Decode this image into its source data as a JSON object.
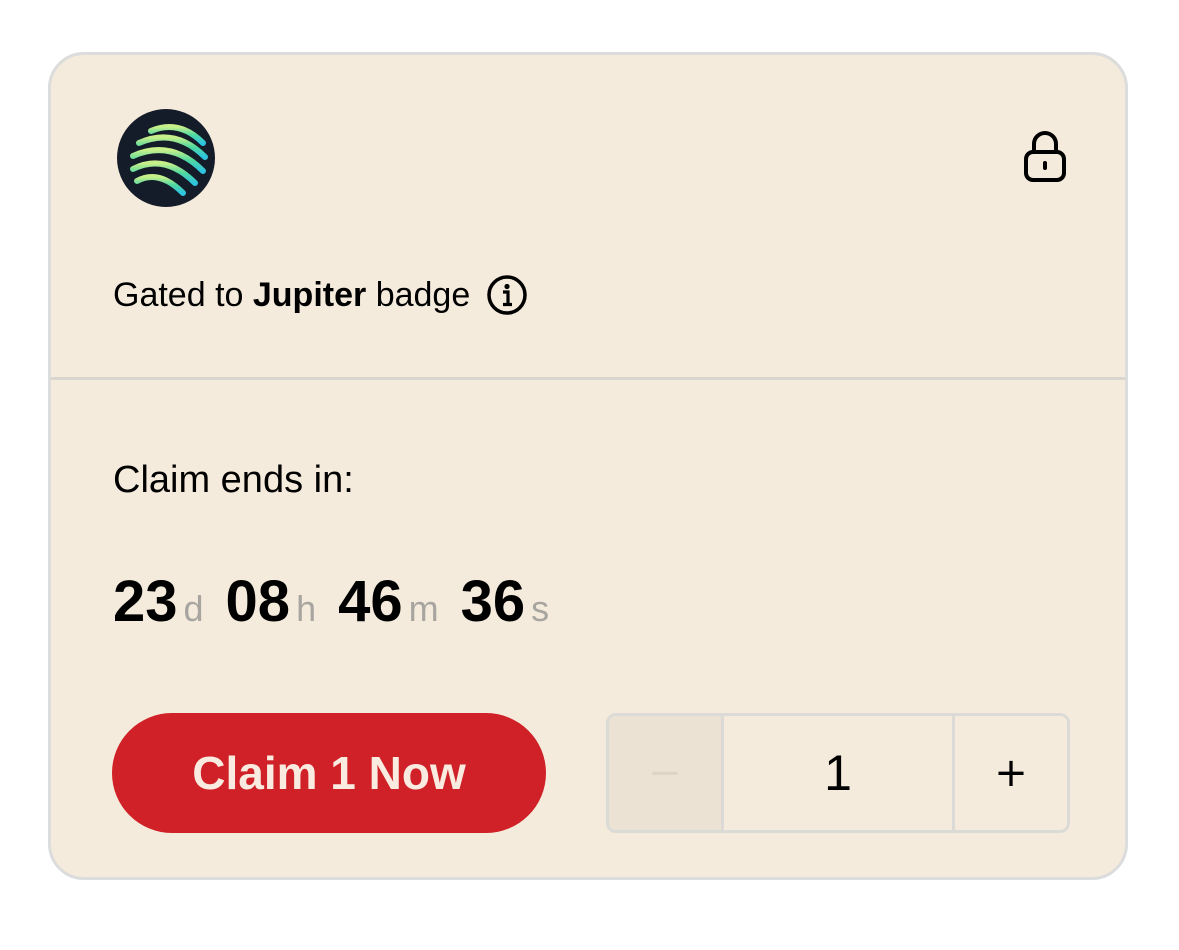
{
  "header": {
    "logo_icon": "jupiter-logo-icon",
    "lock_icon": "lock-icon"
  },
  "gating": {
    "prefix": "Gated to",
    "badge_name": "Jupiter",
    "suffix": "badge",
    "info_icon": "info-icon"
  },
  "claim": {
    "label": "Claim ends in:",
    "countdown": [
      {
        "value": "23",
        "unit": "d"
      },
      {
        "value": "08",
        "unit": "h"
      },
      {
        "value": "46",
        "unit": "m"
      },
      {
        "value": "36",
        "unit": "s"
      }
    ],
    "button_label": "Claim 1 Now"
  },
  "quantity": {
    "minus_label": "−",
    "value": "1",
    "plus_label": "+"
  },
  "colors": {
    "card_background": "#f5ebdc",
    "button_red": "#cf2127",
    "unit_gray": "#a8a5a0"
  }
}
